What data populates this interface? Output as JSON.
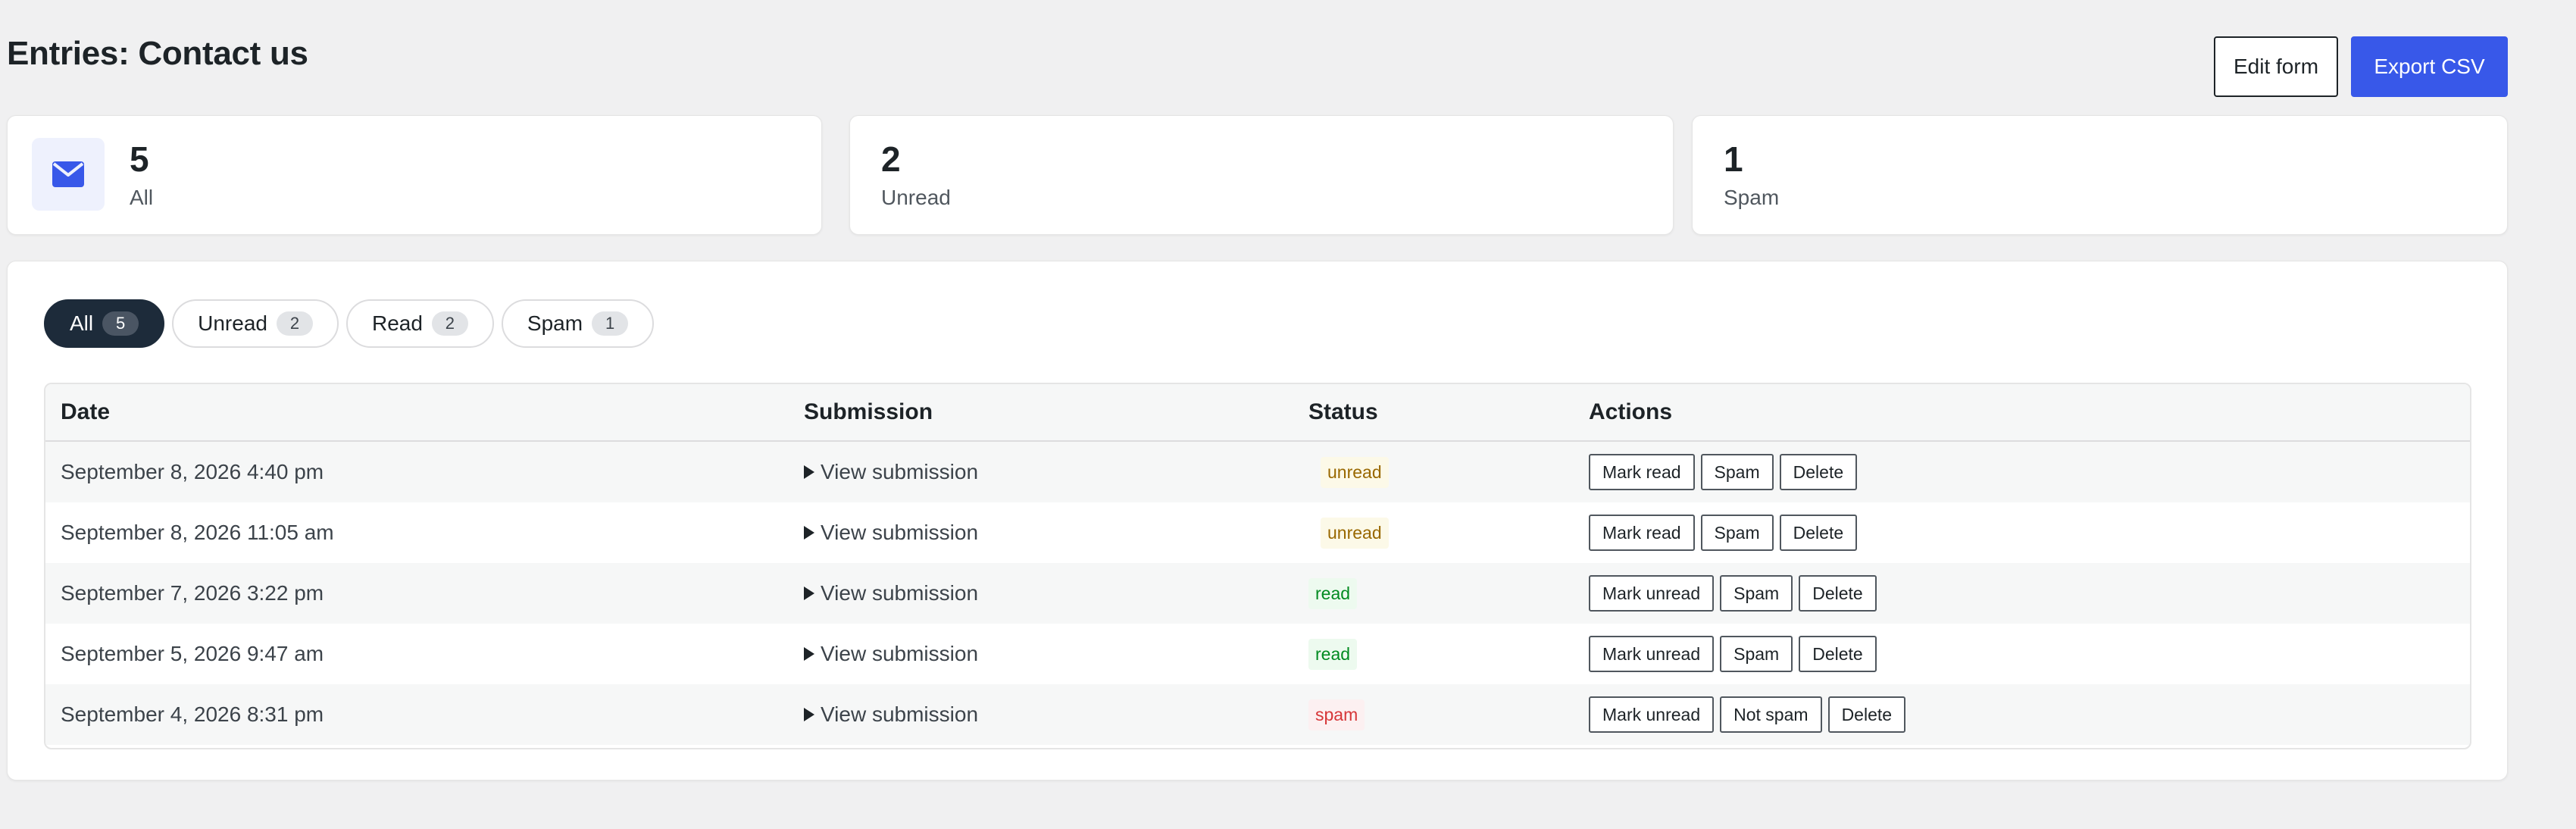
{
  "header": {
    "title": "Entries: Contact us",
    "edit_label": "Edit form",
    "export_label": "Export CSV"
  },
  "stats": [
    {
      "value": "5",
      "label": "All",
      "icon": "envelope-icon"
    },
    {
      "value": "2",
      "label": "Unread"
    },
    {
      "value": "1",
      "label": "Spam"
    }
  ],
  "filters": [
    {
      "label": "All",
      "count": "5",
      "active": true
    },
    {
      "label": "Unread",
      "count": "2"
    },
    {
      "label": "Read",
      "count": "2"
    },
    {
      "label": "Spam",
      "count": "1"
    }
  ],
  "table": {
    "columns": [
      "Date",
      "Submission",
      "Status",
      "Actions"
    ],
    "rows": [
      {
        "date": "September 8, 2026 4:40 pm",
        "submission": "View submission",
        "status": "unread",
        "actions": [
          "Mark read",
          "Spam",
          "Delete"
        ]
      },
      {
        "date": "September 8, 2026 11:05 am",
        "submission": "View submission",
        "status": "unread",
        "actions": [
          "Mark read",
          "Spam",
          "Delete"
        ]
      },
      {
        "date": "September 7, 2026 3:22 pm",
        "submission": "View submission",
        "status": "read",
        "actions": [
          "Mark unread",
          "Spam",
          "Delete"
        ]
      },
      {
        "date": "September 5, 2026 9:47 am",
        "submission": "View submission",
        "status": "read",
        "actions": [
          "Mark unread",
          "Spam",
          "Delete"
        ]
      },
      {
        "date": "September 4, 2026 8:31 pm",
        "submission": "View submission",
        "status": "spam",
        "actions": [
          "Mark unread",
          "Not spam",
          "Delete"
        ]
      }
    ]
  },
  "colors": {
    "accent": "#3858e9",
    "active_pill": "#1d2b3a",
    "unread": "#996800",
    "read": "#008a20",
    "spam": "#d63638"
  }
}
